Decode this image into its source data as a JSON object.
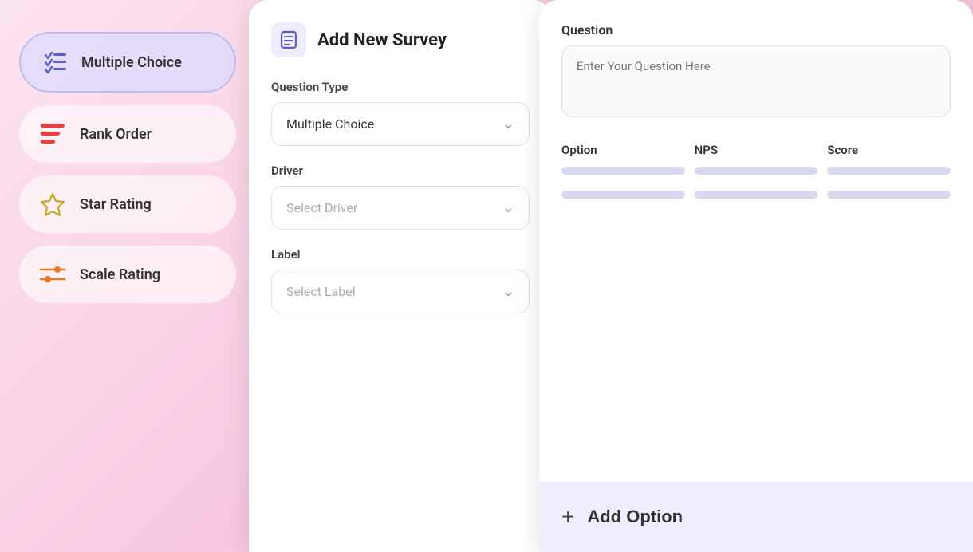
{
  "background": {
    "color": "#f9d8e8"
  },
  "sidebar": {
    "items": [
      {
        "id": "multiple-choice",
        "label": "Multiple Choice",
        "icon": "multichoice",
        "active": true
      },
      {
        "id": "rank-order",
        "label": "Rank Order",
        "icon": "rank",
        "active": false
      },
      {
        "id": "star-rating",
        "label": "Star Rating",
        "icon": "star",
        "active": false
      },
      {
        "id": "scale-rating",
        "label": "Scale Rating",
        "icon": "scale",
        "active": false
      }
    ]
  },
  "form_panel": {
    "header_title": "Add New Survey",
    "question_type_label": "Question Type",
    "question_type_value": "Multiple Choice",
    "driver_label": "Driver",
    "driver_placeholder": "Select Driver",
    "label_label": "Label",
    "label_placeholder": "Select Label"
  },
  "options_panel": {
    "question_label": "Question",
    "question_placeholder": "Enter Your Question Here",
    "columns": [
      "Option",
      "NPS",
      "Score"
    ],
    "rows": [
      {
        "option_bar": true,
        "nps_bar": true,
        "score_bar": true
      },
      {
        "option_bar": true,
        "nps_bar": true,
        "score_bar": true
      }
    ],
    "add_option_label": "Add Option"
  }
}
